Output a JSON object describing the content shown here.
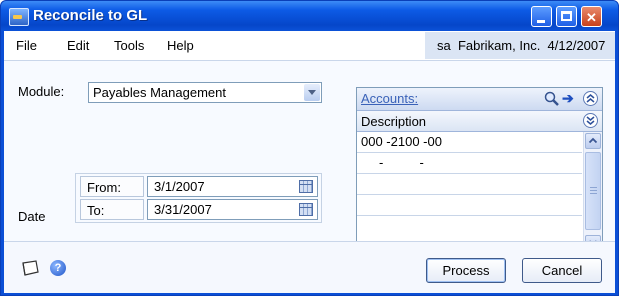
{
  "window": {
    "title": "Reconcile to GL",
    "minimize_symbol": "",
    "close_symbol": "✕"
  },
  "menubar": {
    "items": [
      "File",
      "Edit",
      "Tools",
      "Help"
    ],
    "company_info": "sa  Fabrikam, Inc.  4/12/2007"
  },
  "form": {
    "module_label": "Module:",
    "module_value": "Payables Management",
    "date_label": "Date",
    "from_label": "From:",
    "from_value": "3/1/2007",
    "to_label": "To:",
    "to_value": "3/31/2007"
  },
  "accounts": {
    "link_label": "Accounts:",
    "column_header": "Description",
    "rows": [
      "000 -2100 -00",
      "     -          -",
      "",
      ""
    ],
    "go_arrow": "➔",
    "collapse_symbol": "≈",
    "expand_symbol": "≈"
  },
  "footer": {
    "process_label": "Process",
    "cancel_label": "Cancel",
    "help_symbol": "?"
  },
  "icons": {
    "app": "app-icon",
    "search": "magnifier-icon",
    "calendar": "calendar-icon",
    "note": "note-icon",
    "help": "help-icon"
  },
  "colors": {
    "titlebar": "#0b52d8",
    "link": "#3a62b8",
    "close_button": "#c7411b"
  }
}
